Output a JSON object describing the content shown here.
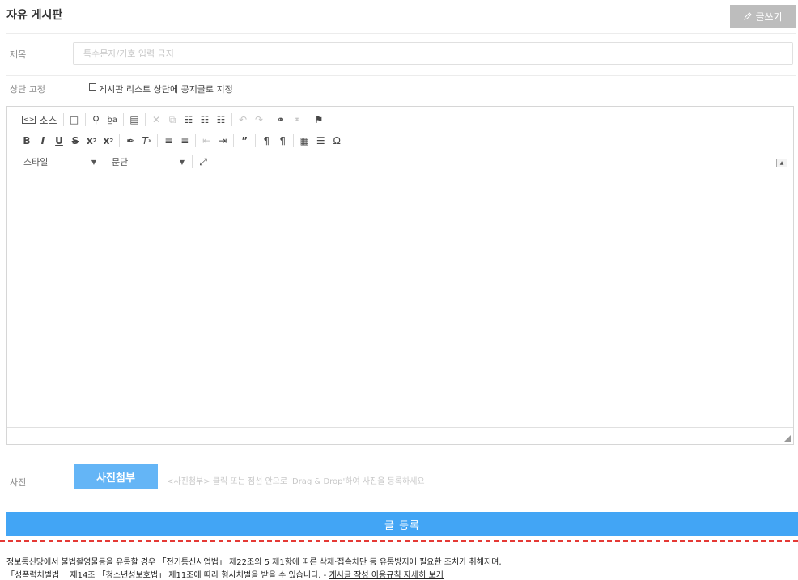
{
  "header": {
    "title": "자유 게시판",
    "write_button": "글쓰기"
  },
  "form": {
    "title_label": "제목",
    "title_placeholder": "특수문자/기호 입력 금지",
    "title_value": "",
    "pin_label": "상단 고정",
    "pin_checkbox_text": "게시판 리스트 상단에 공지글로 지정",
    "pin_checked": false
  },
  "editor": {
    "source_label": "소스",
    "style_combo": "스타일",
    "paragraph_combo": "문단",
    "content": ""
  },
  "attachment": {
    "label": "사진",
    "button": "사진첨부",
    "hint": "<사진첨부> 클릭 또는 점선 안으로 'Drag & Drop'하여 사진을 등록하세요"
  },
  "submit_button": "글 등록",
  "notice": {
    "line1": "정보통신망에서 불법촬영물등을 유통할 경우 「전기통신사업법」 제22조의 5 제1항에 따른 삭제·접속차단 등 유통방지에 필요한 조치가 취해지며,",
    "line2": "「성폭력처벌법」 제14조 「청소년성보호법」 제11조에 따라 형사처벌을 받을 수 있습니다. - ",
    "link": "게시글 작성 이용규칙 자세히 보기"
  },
  "colors": {
    "write_button_bg": "#bdbdbd",
    "photo_button_bg": "#64b5f6",
    "submit_button_bg": "#42a5f5",
    "dashed_border": "#e53935"
  }
}
